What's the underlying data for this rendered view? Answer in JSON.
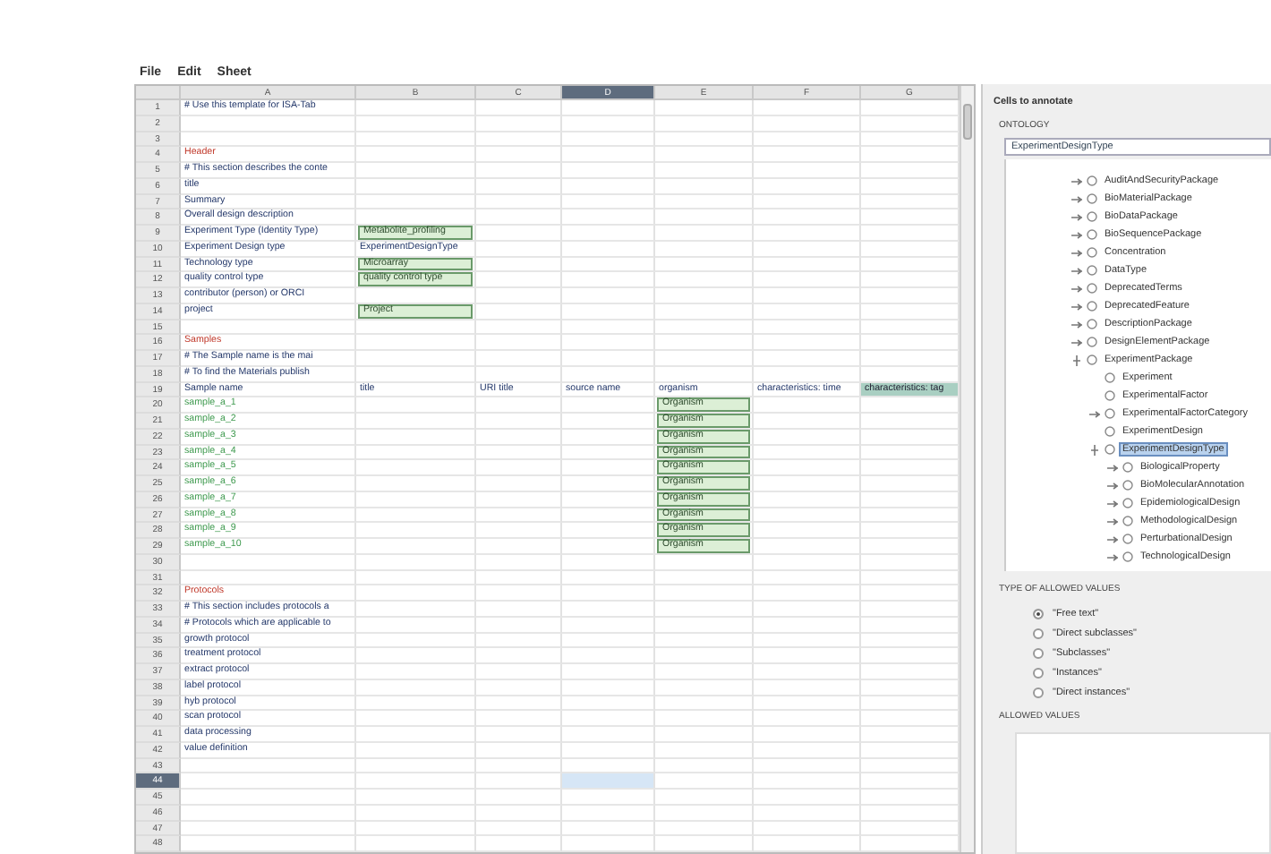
{
  "menu": [
    {
      "label": "File"
    },
    {
      "label": "Edit"
    },
    {
      "label": "Sheet"
    }
  ],
  "sheet": {
    "columns": [
      {
        "label": "A",
        "selected": false
      },
      {
        "label": "B",
        "selected": false
      },
      {
        "label": "C",
        "selected": false
      },
      {
        "label": "D",
        "selected": true
      },
      {
        "label": "E",
        "selected": false
      },
      {
        "label": "F",
        "selected": false
      },
      {
        "label": "G",
        "selected": false
      }
    ],
    "rows": [
      {
        "number": "1",
        "selected": false,
        "a": {
          "text": "# Use this template for ISA-Tab",
          "kind": "text"
        }
      },
      {
        "number": "2",
        "selected": false
      },
      {
        "number": "3",
        "selected": false
      },
      {
        "number": "4",
        "selected": false,
        "a": {
          "text": "Header",
          "kind": "section"
        }
      },
      {
        "number": "5",
        "selected": false,
        "a": {
          "text": "# This section describes the conte",
          "kind": "text"
        }
      },
      {
        "number": "6",
        "selected": false,
        "a": {
          "text": "title",
          "kind": "text"
        }
      },
      {
        "number": "7",
        "selected": false,
        "a": {
          "text": "Summary",
          "kind": "text"
        }
      },
      {
        "number": "8",
        "selected": false,
        "a": {
          "text": "Overall design description",
          "kind": "text"
        }
      },
      {
        "number": "9",
        "selected": false,
        "a": {
          "text": "Experiment Type (Identity Type)",
          "kind": "text"
        },
        "b": {
          "text": "Metabolite_profiling",
          "kind": "term"
        }
      },
      {
        "number": "10",
        "selected": false,
        "a": {
          "text": "Experiment Design type",
          "kind": "text"
        },
        "b": {
          "text": "ExperimentDesignType",
          "kind": "text"
        }
      },
      {
        "number": "11",
        "selected": false,
        "a": {
          "text": "Technology type",
          "kind": "text"
        },
        "b": {
          "text": "Microarray",
          "kind": "term"
        }
      },
      {
        "number": "12",
        "selected": false,
        "a": {
          "text": "quality control type",
          "kind": "text"
        },
        "b": {
          "text": "quality control type",
          "kind": "term"
        }
      },
      {
        "number": "13",
        "selected": false,
        "a": {
          "text": "contributor (person) or ORCI",
          "kind": "text"
        }
      },
      {
        "number": "14",
        "selected": false,
        "a": {
          "text": "project",
          "kind": "text"
        },
        "b": {
          "text": "Project",
          "kind": "term"
        }
      },
      {
        "number": "15",
        "selected": false
      },
      {
        "number": "16",
        "selected": false,
        "a": {
          "text": "Samples",
          "kind": "section"
        }
      },
      {
        "number": "17",
        "selected": false,
        "a": {
          "text": "# The Sample name is the mai",
          "kind": "text"
        }
      },
      {
        "number": "18",
        "selected": false,
        "a": {
          "text": "# To find the Materials publish",
          "kind": "text"
        }
      },
      {
        "number": "19",
        "selected": false,
        "a": {
          "text": "Sample name",
          "kind": "text"
        },
        "b": {
          "text": "title",
          "kind": "text"
        },
        "c": {
          "text": "URI title",
          "kind": "text"
        },
        "d": {
          "text": "source name",
          "kind": "text"
        },
        "e": {
          "text": "organism",
          "kind": "text"
        },
        "f": {
          "text": "characteristics: time",
          "kind": "text"
        },
        "g": {
          "text": "characteristics: tag",
          "kind": "highlight"
        }
      },
      {
        "number": "20",
        "selected": false,
        "a": {
          "text": "sample_a_1",
          "kind": "sample"
        },
        "e": {
          "text": "Organism",
          "kind": "term"
        }
      },
      {
        "number": "21",
        "selected": false,
        "a": {
          "text": "sample_a_2",
          "kind": "sample"
        },
        "e": {
          "text": "Organism",
          "kind": "term"
        }
      },
      {
        "number": "22",
        "selected": false,
        "a": {
          "text": "sample_a_3",
          "kind": "sample"
        },
        "e": {
          "text": "Organism",
          "kind": "term"
        }
      },
      {
        "number": "23",
        "selected": false,
        "a": {
          "text": "sample_a_4",
          "kind": "sample"
        },
        "e": {
          "text": "Organism",
          "kind": "term"
        }
      },
      {
        "number": "24",
        "selected": false,
        "a": {
          "text": "sample_a_5",
          "kind": "sample"
        },
        "e": {
          "text": "Organism",
          "kind": "term"
        }
      },
      {
        "number": "25",
        "selected": false,
        "a": {
          "text": "sample_a_6",
          "kind": "sample"
        },
        "e": {
          "text": "Organism",
          "kind": "term"
        }
      },
      {
        "number": "26",
        "selected": false,
        "a": {
          "text": "sample_a_7",
          "kind": "sample"
        },
        "e": {
          "text": "Organism",
          "kind": "term"
        }
      },
      {
        "number": "27",
        "selected": false,
        "a": {
          "text": "sample_a_8",
          "kind": "sample"
        },
        "e": {
          "text": "Organism",
          "kind": "term"
        }
      },
      {
        "number": "28",
        "selected": false,
        "a": {
          "text": "sample_a_9",
          "kind": "sample"
        },
        "e": {
          "text": "Organism",
          "kind": "term"
        }
      },
      {
        "number": "29",
        "selected": false,
        "a": {
          "text": "sample_a_10",
          "kind": "sample"
        },
        "e": {
          "text": "Organism",
          "kind": "term"
        }
      },
      {
        "number": "30",
        "selected": false
      },
      {
        "number": "31",
        "selected": false
      },
      {
        "number": "32",
        "selected": false,
        "a": {
          "text": "Protocols",
          "kind": "section"
        }
      },
      {
        "number": "33",
        "selected": false,
        "a": {
          "text": "# This section includes protocols a",
          "kind": "text"
        }
      },
      {
        "number": "34",
        "selected": false,
        "a": {
          "text": "# Protocols which are applicable to",
          "kind": "text"
        }
      },
      {
        "number": "35",
        "selected": false,
        "a": {
          "text": "growth protocol",
          "kind": "text"
        }
      },
      {
        "number": "36",
        "selected": false,
        "a": {
          "text": "treatment protocol",
          "kind": "text"
        }
      },
      {
        "number": "37",
        "selected": false,
        "a": {
          "text": "extract protocol",
          "kind": "text"
        }
      },
      {
        "number": "38",
        "selected": false,
        "a": {
          "text": "label protocol",
          "kind": "text"
        }
      },
      {
        "number": "39",
        "selected": false,
        "a": {
          "text": "hyb protocol",
          "kind": "text"
        }
      },
      {
        "number": "40",
        "selected": false,
        "a": {
          "text": "scan protocol",
          "kind": "text"
        }
      },
      {
        "number": "41",
        "selected": false,
        "a": {
          "text": "data processing",
          "kind": "text"
        }
      },
      {
        "number": "42",
        "selected": false,
        "a": {
          "text": "value definition",
          "kind": "text"
        }
      },
      {
        "number": "43",
        "selected": false
      },
      {
        "number": "44",
        "selected": true
      },
      {
        "number": "45",
        "selected": false
      },
      {
        "number": "46",
        "selected": false
      },
      {
        "number": "47",
        "selected": false
      },
      {
        "number": "48",
        "selected": false
      }
    ]
  },
  "panel": {
    "title": "Cells to annotate",
    "ontology_label": "ONTOLOGY",
    "ontology_value": "ExperimentDesignType",
    "tree": [
      {
        "label": "AuditAndSecurityPackage",
        "kind": "branch",
        "expanded": false,
        "selected": false
      },
      {
        "label": "BioMaterialPackage",
        "kind": "branch",
        "expanded": false,
        "selected": false
      },
      {
        "label": "BioDataPackage",
        "kind": "branch",
        "expanded": false,
        "selected": false
      },
      {
        "label": "BioSequencePackage",
        "kind": "branch",
        "expanded": false,
        "selected": false
      },
      {
        "label": "Concentration",
        "kind": "branch",
        "expanded": false,
        "selected": false
      },
      {
        "label": "DataType",
        "kind": "branch",
        "expanded": false,
        "selected": false
      },
      {
        "label": "DeprecatedTerms",
        "kind": "branch",
        "expanded": false,
        "selected": false
      },
      {
        "label": "DeprecatedFeature",
        "kind": "branch",
        "expanded": false,
        "selected": false
      },
      {
        "label": "DescriptionPackage",
        "kind": "branch",
        "expanded": false,
        "selected": false
      },
      {
        "label": "DesignElementPackage",
        "kind": "branch",
        "expanded": false,
        "selected": false
      },
      {
        "label": "ExperimentPackage",
        "kind": "branch",
        "expanded": true,
        "selected": false,
        "children": [
          {
            "label": "Experiment",
            "kind": "leaf",
            "selected": false
          },
          {
            "label": "ExperimentalFactor",
            "kind": "leaf",
            "selected": false
          },
          {
            "label": "ExperimentalFactorCategory",
            "kind": "branch",
            "expanded": false,
            "selected": false
          },
          {
            "label": "ExperimentDesign",
            "kind": "leaf",
            "selected": false
          },
          {
            "label": "ExperimentDesignType",
            "kind": "branch",
            "expanded": true,
            "selected": true,
            "children": [
              {
                "label": "BiologicalProperty",
                "kind": "branch",
                "expanded": false,
                "selected": false
              },
              {
                "label": "BioMolecularAnnotation",
                "kind": "branch",
                "expanded": false,
                "selected": false
              },
              {
                "label": "EpidemiologicalDesign",
                "kind": "branch",
                "expanded": false,
                "selected": false
              },
              {
                "label": "MethodologicalDesign",
                "kind": "branch",
                "expanded": false,
                "selected": false
              },
              {
                "label": "PerturbationalDesign",
                "kind": "branch",
                "expanded": false,
                "selected": false
              },
              {
                "label": "TechnologicalDesign",
                "kind": "branch",
                "expanded": false,
                "selected": false
              }
            ]
          }
        ]
      }
    ],
    "allowed_type_label": "TYPE OF ALLOWED VALUES",
    "allowed_types": [
      {
        "label": "\"Free text\"",
        "selected": true
      },
      {
        "label": "\"Direct subclasses\"",
        "selected": false
      },
      {
        "label": "\"Subclasses\"",
        "selected": false
      },
      {
        "label": "\"Instances\"",
        "selected": false
      },
      {
        "label": "\"Direct instances\"",
        "selected": false
      }
    ],
    "allowed_values_label": "ALLOWED VALUES"
  }
}
